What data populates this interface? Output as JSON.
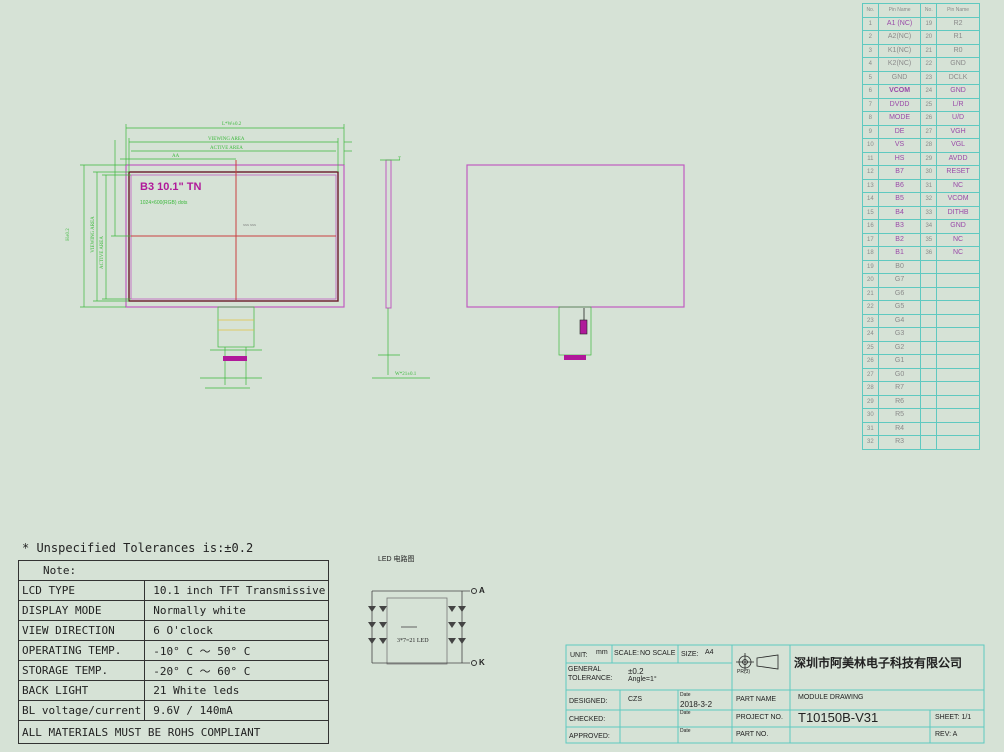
{
  "drawing": {
    "panel_label": "B3 10.1\" TN",
    "panel_sublabel": "1024×600(RGB) dots",
    "center_mark": "xxx xxx",
    "dim_outline": "L*W±0.2",
    "dim_viewing": "VIEWING AREA",
    "dim_active": "ACTIVE AREA",
    "dim_aa": "AA",
    "dim_side_thickness": "T",
    "dim_fpc_width": "W*21±0.1",
    "dim_left_outline": "H±0.2",
    "dim_left_viewing": "VIEWING AREA",
    "dim_left_active": "ACTIVE AREA"
  },
  "pin_table": {
    "headers": [
      "No.",
      "Pin Name",
      "No.",
      "Pin Name"
    ],
    "rows": [
      [
        "1",
        "A1 (NC)",
        "19",
        "R2"
      ],
      [
        "2",
        "A2(NC)",
        "20",
        "R1"
      ],
      [
        "3",
        "K1(NC)",
        "21",
        "R0"
      ],
      [
        "4",
        "K2(NC)",
        "22",
        "GND"
      ],
      [
        "5",
        "GND",
        "23",
        "DCLK"
      ],
      [
        "6",
        "VCOM",
        "24",
        "GND"
      ],
      [
        "7",
        "DVDD",
        "25",
        "L/R"
      ],
      [
        "8",
        "MODE",
        "26",
        "U/D"
      ],
      [
        "9",
        "DE",
        "27",
        "VGH"
      ],
      [
        "10",
        "VS",
        "28",
        "VGL"
      ],
      [
        "11",
        "HS",
        "29",
        "AVDD"
      ],
      [
        "12",
        "B7",
        "30",
        "RESET"
      ],
      [
        "13",
        "B6",
        "31",
        "NC"
      ],
      [
        "14",
        "B5",
        "32",
        "VCOM"
      ],
      [
        "15",
        "B4",
        "33",
        "DITHB"
      ],
      [
        "16",
        "B3",
        "34",
        "GND"
      ],
      [
        "17",
        "B2",
        "35",
        "NC"
      ],
      [
        "18",
        "B1",
        "36",
        "NC"
      ],
      [
        "19",
        "B0",
        "",
        ""
      ],
      [
        "20",
        "G7",
        "",
        ""
      ],
      [
        "21",
        "G6",
        "",
        ""
      ],
      [
        "22",
        "G5",
        "",
        ""
      ],
      [
        "23",
        "G4",
        "",
        ""
      ],
      [
        "24",
        "G3",
        "",
        ""
      ],
      [
        "25",
        "G2",
        "",
        ""
      ],
      [
        "26",
        "G1",
        "",
        ""
      ],
      [
        "27",
        "G0",
        "",
        ""
      ],
      [
        "28",
        "R7",
        "",
        ""
      ],
      [
        "29",
        "R6",
        "",
        ""
      ],
      [
        "30",
        "R5",
        "",
        ""
      ],
      [
        "31",
        "R4",
        "",
        ""
      ],
      [
        "32",
        "R3",
        "",
        ""
      ]
    ]
  },
  "led_circuit": {
    "title": "LED  电路图",
    "label": "3*7=21 LED",
    "anode": "A",
    "cathode": "K"
  },
  "notes": {
    "tolerance": "* Unspecified Tolerances is:±0.2",
    "title": "Note:",
    "rows": [
      [
        "LCD TYPE",
        "10.1 inch TFT Transmissive"
      ],
      [
        "DISPLAY MODE",
        "Normally white"
      ],
      [
        "VIEW DIRECTION",
        "6 O'clock"
      ],
      [
        "OPERATING TEMP.",
        "-10° C ～ 50° C"
      ],
      [
        "STORAGE TEMP.",
        "-20° C ～ 60° C"
      ],
      [
        "BACK LIGHT",
        "21 White leds"
      ],
      [
        "BL voltage/current",
        "9.6V / 140mA"
      ]
    ],
    "footer": "ALL MATERIALS MUST BE ROHS COMPLIANT"
  },
  "title_block": {
    "unit_label": "UNIT:",
    "unit_value": "mm",
    "scale_label": "SCALE:",
    "scale_value": "NO SCALE",
    "size_label": "SIZE:",
    "size_value": "A4",
    "general_tolerance": "GENERAL TOLERANCE:",
    "tolerance_value": "±0.2",
    "angle_value": "Angle=1°",
    "projection": "PR(3)",
    "company": "深圳市阿美林电子科技有限公司",
    "designed_label": "DESIGNED:",
    "designed_value": "CZS",
    "date_label": "Date",
    "designed_date": "2018-3-2",
    "checked_label": "CHECKED:",
    "approved_label": "APPROVED:",
    "part_name_label": "PART NAME",
    "part_name_value": "MODULE DRAWING",
    "project_no_label": "PROJECT NO.",
    "project_no_value": "T10150B-V31",
    "part_no_label": "PART NO.",
    "sheet_label": "SHEET: 1/1",
    "rev_label": "REV: A"
  },
  "colors": {
    "background": "#d6e2d6",
    "dimension": "#3cb83c",
    "outline": "#c05cc0",
    "panel": "#c94040",
    "table": "#5fc9c0",
    "accent": "#b0199a"
  }
}
